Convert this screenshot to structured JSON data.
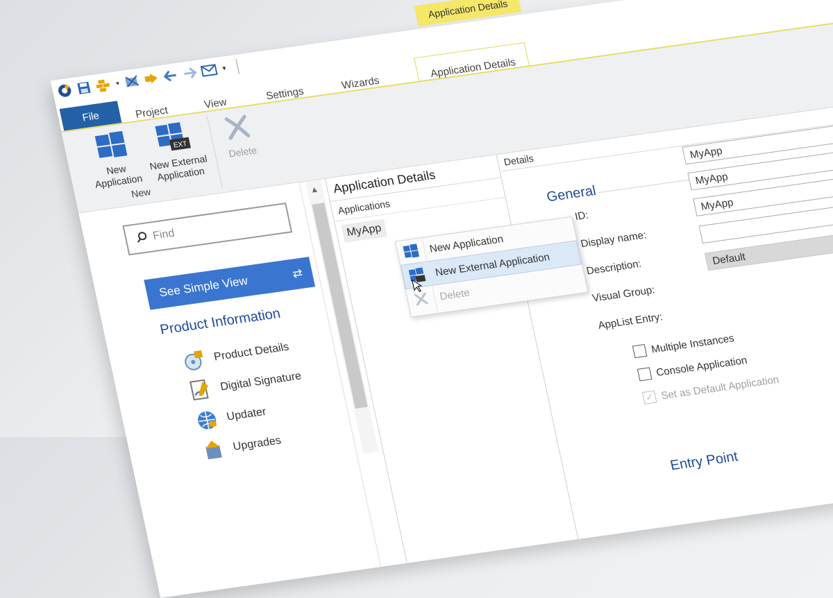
{
  "contextual_tab_group": "Application Details",
  "tabs": {
    "file": "File",
    "project": "Project",
    "view": "View",
    "settings": "Settings",
    "wizards": "Wizards",
    "active": "Application Details"
  },
  "ribbon": {
    "new_application": "New Application",
    "new_external_application": "New External Application",
    "delete": "Delete",
    "group_label": "New",
    "ext_badge": "EXT"
  },
  "leftnav": {
    "search_placeholder": "Find",
    "simple_view": "See Simple View",
    "title": "Product Information",
    "items": [
      {
        "label": "Product Details",
        "icon": "product-details-icon"
      },
      {
        "label": "Digital Signature",
        "icon": "digital-signature-icon"
      },
      {
        "label": "Updater",
        "icon": "updater-icon"
      },
      {
        "label": "Upgrades",
        "icon": "upgrades-icon"
      }
    ]
  },
  "middle": {
    "header": "Application Details",
    "sub": "Applications",
    "items": [
      "MyApp"
    ]
  },
  "context_menu": {
    "items": [
      {
        "label": "New Application",
        "state": "normal"
      },
      {
        "label": "New External Application",
        "state": "hover"
      },
      {
        "label": "Delete",
        "state": "disabled"
      }
    ]
  },
  "details": {
    "header": "Details",
    "section": "General",
    "labels": {
      "id": "ID:",
      "display_name": "Display name:",
      "description": "Description:",
      "visual_group": "Visual Group:",
      "applist": "AppList Entry:"
    },
    "values": {
      "id": "MyApp",
      "display_name": "MyApp",
      "description": "MyApp",
      "visual_group": "",
      "applist": "Default"
    },
    "checkboxes": [
      {
        "label": "Multiple Instances",
        "checked": false,
        "disabled": false
      },
      {
        "label": "Console Application",
        "checked": false,
        "disabled": false
      },
      {
        "label": "Set as Default Application",
        "checked": true,
        "disabled": true
      }
    ],
    "section2": "Entry Point"
  },
  "colors": {
    "accent": "#2360a8",
    "button_blue": "#3a76d0",
    "context_yellow": "#f4e76a",
    "heading_blue": "#1e4a9a"
  }
}
